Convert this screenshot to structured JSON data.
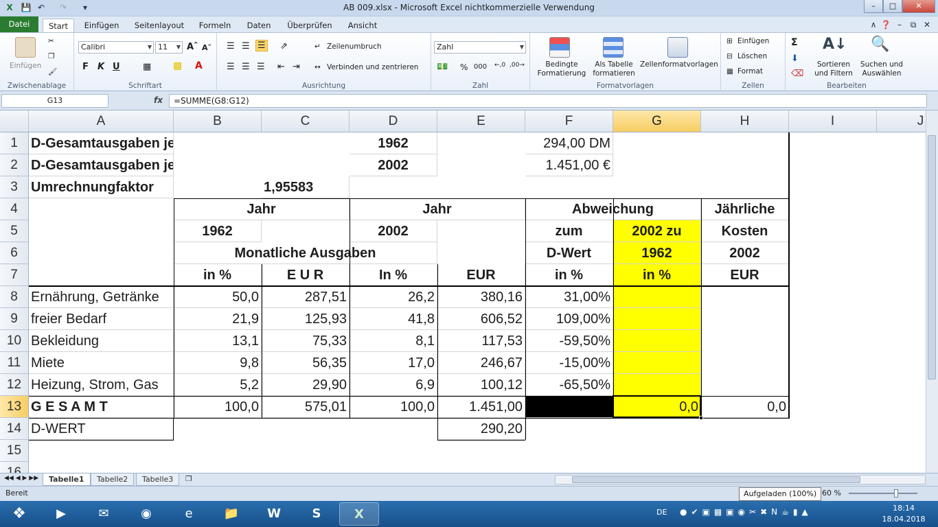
{
  "window": {
    "title": "AB 009.xlsx  -  Microsoft Excel nichtkommerzielle Verwendung"
  },
  "ribbon_tabs": [
    "Datei",
    "Start",
    "Einfügen",
    "Seitenlayout",
    "Formeln",
    "Daten",
    "Überprüfen",
    "Ansicht"
  ],
  "ribbon": {
    "clipboard": {
      "paste": "Einfügen",
      "label": "Zwischenablage"
    },
    "font": {
      "name": "Calibri",
      "size": "11",
      "label": "Schriftart"
    },
    "alignment": {
      "wrap": "Zeilenumbruch",
      "merge": "Verbinden und zentrieren",
      "label": "Ausrichtung"
    },
    "number": {
      "format": "Zahl",
      "label": "Zahl"
    },
    "styles": {
      "conditional": "Bedingte Formatierung",
      "table": "Als Tabelle formatieren",
      "cell_styles": "Zellenformatvorlagen",
      "label": "Formatvorlagen"
    },
    "cells": {
      "insert": "Einfügen",
      "delete": "Löschen",
      "format": "Format",
      "label": "Zellen"
    },
    "editing": {
      "sort": "Sortieren und Filtern",
      "find": "Suchen und Auswählen",
      "label": "Bearbeiten"
    }
  },
  "formula_bar": {
    "name_box": "G13",
    "fx": "fx",
    "formula": "=SUMME(G8:G12)"
  },
  "columns": [
    "A",
    "B",
    "C",
    "D",
    "E",
    "F",
    "G",
    "H",
    "I",
    "J"
  ],
  "rows": [
    "1",
    "2",
    "3",
    "4",
    "5",
    "6",
    "7",
    "8",
    "9",
    "10",
    "11",
    "12",
    "13",
    "14",
    "15",
    "16"
  ],
  "cells": {
    "A1": "D-Gesamtausgaben je Monat",
    "D1": "1962",
    "F1": "294,00 DM",
    "A2": "D-Gesamtausgaben je Monat",
    "D2": "2002",
    "F2": "1.451,00 €",
    "A3": "Umrechnungfaktor",
    "C3": "1,95583",
    "B4": "Jahr",
    "D4": "Jahr",
    "F4": "Abweichung",
    "H4": "Jährliche",
    "B5": "1962",
    "D5": "2002",
    "F5": "zum",
    "G5": "2002 zu",
    "H5": "Kosten",
    "B6": "Monatliche Ausgaben",
    "F6": "D-Wert",
    "G6": "1962",
    "H6": "2002",
    "B7": "in %",
    "C7": "E U R",
    "D7": "In %",
    "E7": "EUR",
    "F7": "in %",
    "G7": "in %",
    "H7": "EUR",
    "A8": "Ernährung, Getränke",
    "B8": "50,0",
    "C8": "287,51",
    "D8": "26,2",
    "E8": "380,16",
    "F8": "31,00%",
    "A9": "freier Bedarf",
    "B9": "21,9",
    "C9": "125,93",
    "D9": "41,8",
    "E9": "606,52",
    "F9": "109,00%",
    "A10": "Bekleidung",
    "B10": "13,1",
    "C10": "75,33",
    "D10": "8,1",
    "E10": "117,53",
    "F10": "-59,50%",
    "A11": "Miete",
    "B11": "9,8",
    "C11": "56,35",
    "D11": "17,0",
    "E11": "246,67",
    "F11": "-15,00%",
    "A12": "Heizung, Strom, Gas",
    "B12": "5,2",
    "C12": "29,90",
    "D12": "6,9",
    "E12": "100,12",
    "F12": "-65,50%",
    "A13": "G E S A M T",
    "B13": "100,0",
    "C13": "575,01",
    "D13": "100,0",
    "E13": "1.451,00",
    "G13": "0,0",
    "H13": "0,0",
    "A14": "D-WERT",
    "E14": "290,20"
  },
  "sheets": [
    "Tabelle1",
    "Tabelle2",
    "Tabelle3"
  ],
  "status": {
    "mode": "Bereit",
    "zoom": "160 %",
    "tooltip": "Aufgeladen (100%)"
  },
  "taskbar": {
    "lang": "DE",
    "time": "18:14",
    "date": "18.04.2018"
  },
  "colors": {
    "highlight": "#ffff00",
    "accent": "#2a7c31"
  }
}
